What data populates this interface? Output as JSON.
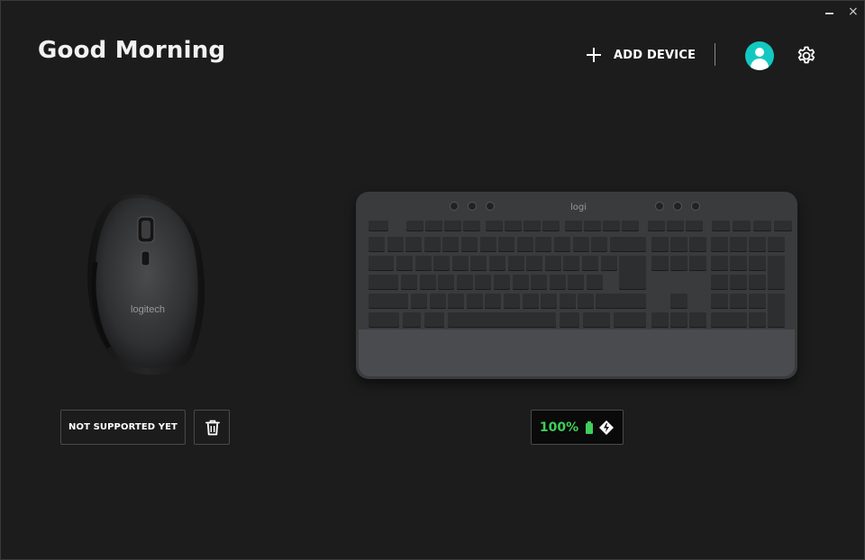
{
  "window": {
    "minimize_label": "",
    "close_label": "×"
  },
  "header": {
    "greeting": "Good Morning",
    "add_device_label": "ADD DEVICE"
  },
  "devices": [
    {
      "kind": "mouse",
      "brand_text": "logitech",
      "action_label": "NOT SUPPORTED YET",
      "icon": "trash-icon"
    },
    {
      "kind": "keyboard",
      "brand_text": "logi",
      "battery_percent": "100%",
      "battery_icon": "battery-full-icon",
      "connection_icon": "logi-bolt-icon"
    }
  ],
  "colors": {
    "background": "#1c1c1c",
    "accent_avatar": "#12c9c1",
    "battery_green": "#3fcf5a"
  }
}
